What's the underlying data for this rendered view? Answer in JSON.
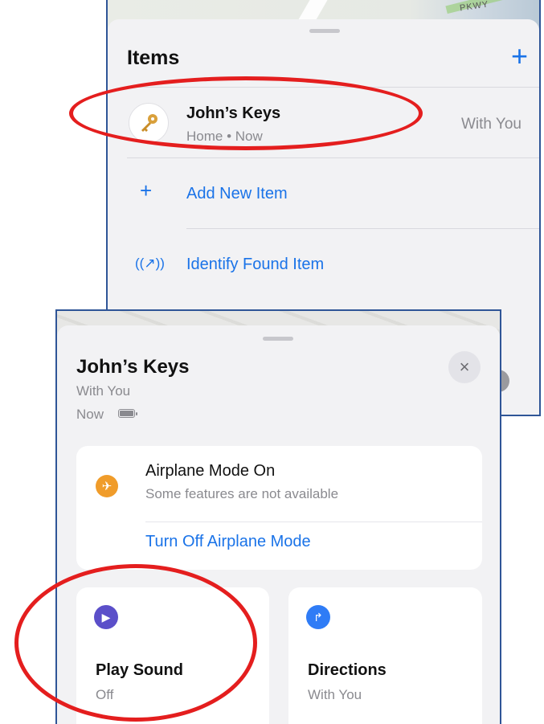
{
  "items_panel": {
    "map_label": "PKWY",
    "title": "Items",
    "add_button_label": "+",
    "item": {
      "name": "John’s Keys",
      "location_time": "Home • Now",
      "status": "With You",
      "icon": "key-icon"
    },
    "add_new_item_label": "Add New Item",
    "identify_found_item_label": "Identify Found Item"
  },
  "detail_panel": {
    "title": "John’s Keys",
    "subtitle": "With You",
    "time": "Now",
    "close_label": "×",
    "airplane_card": {
      "title": "Airplane Mode On",
      "subtitle": "Some features are not available",
      "link": "Turn Off Airplane Mode",
      "icon": "airplane-icon",
      "icon_color": "#f09c2a"
    },
    "actions": [
      {
        "title": "Play Sound",
        "subtitle": "Off",
        "icon": "play-icon",
        "icon_color": "#5b4fc9"
      },
      {
        "title": "Directions",
        "subtitle": "With You",
        "icon": "directions-icon",
        "icon_color": "#2f7cf6"
      }
    ]
  },
  "colors": {
    "accent": "#1a73e8",
    "highlight_circle": "#e41e1e",
    "panel_border": "#2f5597"
  }
}
